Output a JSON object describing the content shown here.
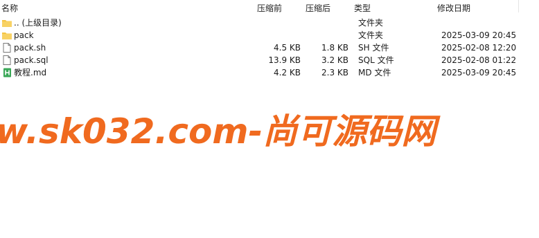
{
  "columns": {
    "name": "名称",
    "before": "压缩前",
    "after": "压缩后",
    "type": "类型",
    "modified": "修改日期"
  },
  "files": [
    {
      "icon": "folder-up-icon",
      "name": ".. (上级目录)",
      "before": "",
      "after": "",
      "type": "文件夹",
      "modified": ""
    },
    {
      "icon": "folder-icon",
      "name": "pack",
      "before": "",
      "after": "",
      "type": "文件夹",
      "modified": "2025-03-09 20:45"
    },
    {
      "icon": "file-icon",
      "name": "pack.sh",
      "before": "4.5 KB",
      "after": "1.8 KB",
      "type": "SH 文件",
      "modified": "2025-02-08 12:20"
    },
    {
      "icon": "file-icon",
      "name": "pack.sql",
      "before": "13.9 KB",
      "after": "3.2 KB",
      "type": "SQL 文件",
      "modified": "2025-02-08 01:22"
    },
    {
      "icon": "markdown-file-icon",
      "name": "教程.md",
      "before": "4.2 KB",
      "after": "2.3 KB",
      "type": "MD 文件",
      "modified": "2025-03-09 20:45"
    }
  ],
  "watermark": "w.sk032.com-尚可源码网",
  "colors": {
    "folder": "#f5c342",
    "markdown": "#3aa757",
    "watermark": "#f06a1f"
  }
}
